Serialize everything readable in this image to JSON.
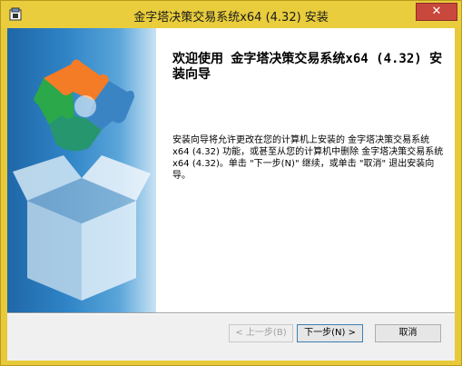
{
  "window": {
    "title": "金字塔决策交易系统x64 (4.32) 安装",
    "close_label": "✕"
  },
  "welcome": {
    "title": "欢迎使用 金字塔决策交易系统x64 (4.32) 安装向导",
    "body": "安装向导将允许更改在您的计算机上安装的 金字塔决策交易系统x64 (4.32) 功能，或甚至从您的计算机中删除 金字塔决策交易系统x64 (4.32)。单击 \"下一步(N)\" 继续，或单击 \"取消\" 退出安装向导。"
  },
  "buttons": {
    "back_label": "< 上一步(B)",
    "next_label": "下一步(N) >",
    "cancel_label": "取消"
  },
  "icons": {
    "title_icon": "installer-icon",
    "banner_art": "puzzle-box-illustration"
  },
  "colors": {
    "titlebar": "#e9cd3c",
    "close_button": "#c9483d",
    "banner": "#2f84c6",
    "default_button_border": "#3c7fb1"
  }
}
